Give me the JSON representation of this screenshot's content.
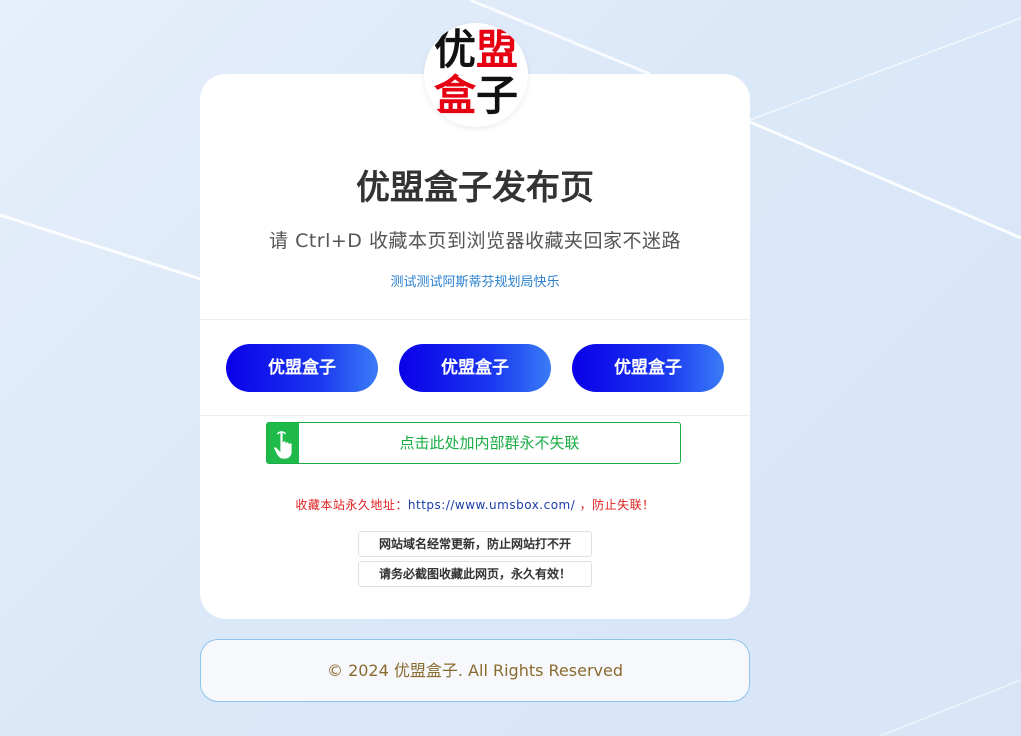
{
  "logo": {
    "chars": [
      "优",
      "盟",
      "盒",
      "子"
    ],
    "colors": {
      "black": "#111111",
      "red": "#e60012"
    }
  },
  "header": {
    "title": "优盟盒子发布页",
    "subtitle": "请 Ctrl+D 收藏本页到浏览器收藏夹回家不迷路",
    "note": "测试测试阿斯蒂芬规划局快乐"
  },
  "buttons": [
    {
      "label": "优盟盒子"
    },
    {
      "label": "优盟盒子"
    },
    {
      "label": "优盟盒子"
    }
  ],
  "join_group": {
    "label": "点击此处加内部群永不失联",
    "icon": "hand-pointer-icon"
  },
  "address": {
    "prefix": "收藏本站永久地址：",
    "url": "https://www.umsbox.com/",
    "suffix": " ，防止失联！"
  },
  "tips": [
    "网站域名经常更新，防止网站打不开",
    "请务必截图收藏此网页，永久有效！"
  ],
  "footer": {
    "copyright": "© 2024 优盟盒子. All Rights Reserved"
  },
  "colors": {
    "button_start": "#0a00e8",
    "button_end": "#3a7cf7",
    "green": "#1aad45",
    "red": "#e02020"
  }
}
